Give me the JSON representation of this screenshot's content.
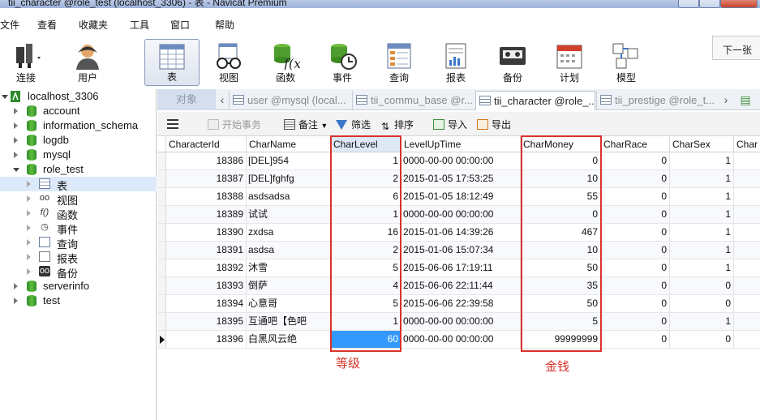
{
  "window": {
    "title": "tii_character @role_test (localhost_3306) - 表 - Navicat Premium"
  },
  "menu": [
    "文件",
    "查看",
    "收藏夹",
    "工具",
    "窗口",
    "帮助"
  ],
  "toolbar": [
    {
      "label": "连接",
      "icon": "plug-icon"
    },
    {
      "label": "用户",
      "icon": "user-icon"
    },
    {
      "label": "表",
      "icon": "table-icon",
      "active": true
    },
    {
      "label": "视图",
      "icon": "glasses-icon"
    },
    {
      "label": "函数",
      "icon": "function-icon"
    },
    {
      "label": "事件",
      "icon": "clock-db-icon"
    },
    {
      "label": "查询",
      "icon": "query-grid-icon"
    },
    {
      "label": "报表",
      "icon": "report-icon"
    },
    {
      "label": "备份",
      "icon": "tape-icon"
    },
    {
      "label": "计划",
      "icon": "calendar-icon"
    },
    {
      "label": "模型",
      "icon": "model-icon"
    }
  ],
  "next_button": "下一张",
  "sidebar": {
    "connection": "localhost_3306",
    "databases": [
      "account",
      "information_schema",
      "logdb",
      "mysql",
      "role_test"
    ],
    "role_test_children": [
      "表",
      "视图",
      "函数",
      "事件",
      "查询",
      "报表",
      "备份"
    ],
    "after": [
      "serverinfo",
      "test"
    ]
  },
  "tabs": {
    "object_tab": "对象",
    "items": [
      {
        "label": "user @mysql (local...",
        "active": false
      },
      {
        "label": "tii_commu_base @r...",
        "active": false
      },
      {
        "label": "tii_character @role_...",
        "active": true
      },
      {
        "label": "tii_prestige @role_t...",
        "active": false
      }
    ]
  },
  "grid_toolbar": {
    "begin_transaction": "开始事务",
    "memo": "备注",
    "filter": "筛选",
    "sort": "排序",
    "import": "导入",
    "export": "导出"
  },
  "table": {
    "columns": [
      "CharacterId",
      "CharName",
      "CharLevel",
      "LevelUpTime",
      "CharMoney",
      "CharRace",
      "CharSex",
      "Char"
    ],
    "rows": [
      [
        "18386",
        "[DEL]954",
        "1",
        "0000-00-00 00:00:00",
        "0",
        "0",
        "1"
      ],
      [
        "18387",
        "[DEL]fghfg",
        "2",
        "2015-01-05 17:53:25",
        "10",
        "0",
        "1"
      ],
      [
        "18388",
        "asdsadsa",
        "6",
        "2015-01-05 18:12:49",
        "55",
        "0",
        "1"
      ],
      [
        "18389",
        "试试",
        "1",
        "0000-00-00 00:00:00",
        "0",
        "0",
        "1"
      ],
      [
        "18390",
        "zxdsa",
        "16",
        "2015-01-06 14:39:26",
        "467",
        "0",
        "1"
      ],
      [
        "18391",
        "asdsa",
        "2",
        "2015-01-06 15:07:34",
        "10",
        "0",
        "1"
      ],
      [
        "18392",
        "沐雪",
        "5",
        "2015-06-06 17:19:11",
        "50",
        "0",
        "1"
      ],
      [
        "18393",
        "倒萨",
        "4",
        "2015-06-06 22:11:44",
        "35",
        "0",
        "0"
      ],
      [
        "18394",
        "心意哥",
        "5",
        "2015-06-06 22:39:58",
        "50",
        "0",
        "0"
      ],
      [
        "18395",
        "互通吧【色吧",
        "1",
        "0000-00-00 00:00:00",
        "5",
        "0",
        "1"
      ],
      [
        "18396",
        "白黑风云绝",
        "60",
        "0000-00-00 00:00:00",
        "99999999",
        "0",
        "0"
      ]
    ]
  },
  "annotations": {
    "level_label": "等级",
    "money_label": "金钱"
  },
  "colors": {
    "annotation": "#d9322c",
    "selected_cell": "#3399ff"
  }
}
